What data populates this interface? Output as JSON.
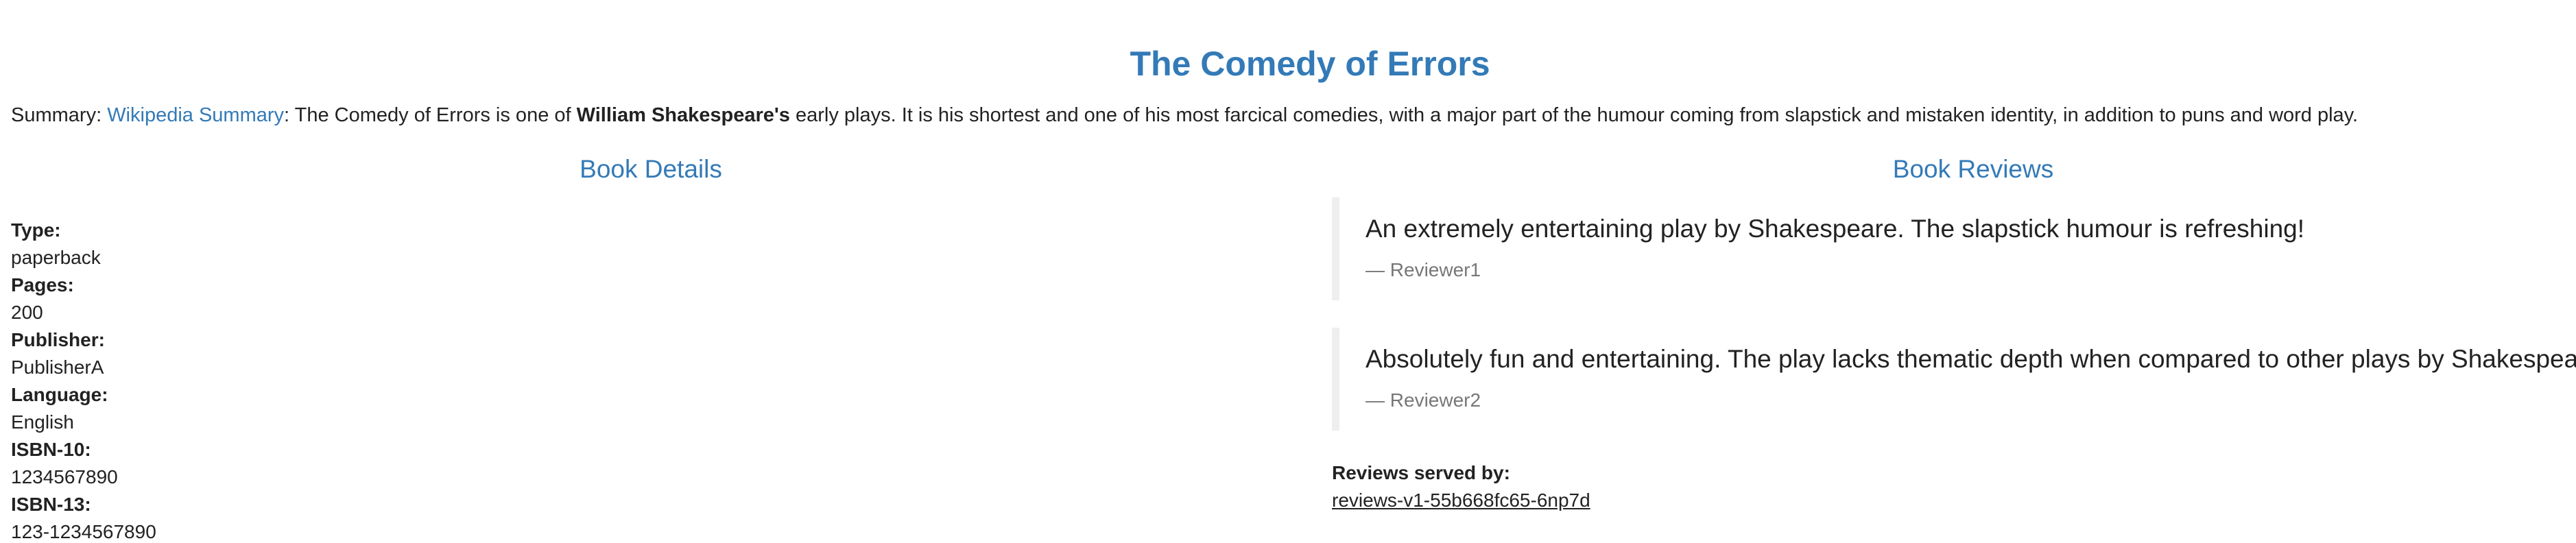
{
  "page_title": "The Comedy of Errors",
  "summary": {
    "label": "Summary: ",
    "link_text": "Wikipedia Summary",
    "text_before_bold": ": The Comedy of Errors is one of ",
    "bold_text": "William Shakespeare's",
    "text_after_bold": " early plays. It is his shortest and one of his most farcical comedies, with a major part of the humour coming from slapstick and mistaken identity, in addition to puns and word play."
  },
  "details": {
    "heading": "Book Details",
    "items": [
      {
        "label": "Type:",
        "value": "paperback"
      },
      {
        "label": "Pages:",
        "value": "200"
      },
      {
        "label": "Publisher:",
        "value": "PublisherA"
      },
      {
        "label": "Language:",
        "value": "English"
      },
      {
        "label": "ISBN-10:",
        "value": "1234567890"
      },
      {
        "label": "ISBN-13:",
        "value": "123-1234567890"
      }
    ]
  },
  "reviews": {
    "heading": "Book Reviews",
    "items": [
      {
        "text": "An extremely entertaining play by Shakespeare. The slapstick humour is refreshing!",
        "author": "— Reviewer1"
      },
      {
        "text": "Absolutely fun and entertaining. The play lacks thematic depth when compared to other plays by Shakespeare.",
        "author": "— Reviewer2"
      }
    ],
    "served_by_label": "Reviews served by:",
    "served_by_value": "reviews-v1-55b668fc65-6np7d"
  },
  "colors": {
    "accent": "#337ab7",
    "text": "#222222",
    "muted": "#777777",
    "quote_border": "#eeeeee"
  }
}
